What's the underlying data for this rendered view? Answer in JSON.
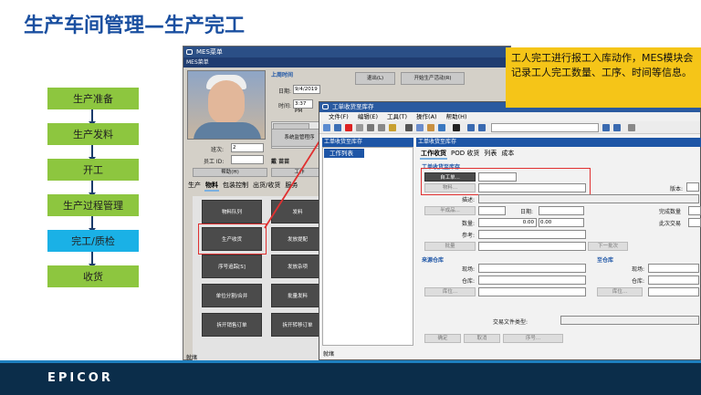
{
  "slide": {
    "title": "生产车间管理—生产完工",
    "footer_logo": "EPICOR"
  },
  "flow": {
    "steps": [
      "生产准备",
      "生产发料",
      "开工",
      "生产过程管理",
      "完工/质检",
      "收货"
    ],
    "active_index": 4
  },
  "callout": {
    "text": "工人完工进行报工入库动作，MES模块会记录工人完工数量、工序、时间等信息。"
  },
  "mes_window": {
    "title": "MES菜单",
    "menu": "MES菜单",
    "clock_header": "上周时间",
    "date_label": "日期:",
    "date_value": "9/4/2019",
    "time_label": "时间:",
    "time_value": "3:37 PM",
    "shift_label": "班次:",
    "shift_value": "2",
    "employee_label": "员工 ID:",
    "employee_value": "",
    "employee_name": "戴 苗苗",
    "help_button": "帮助(H)",
    "work_button": "工作",
    "logout_button": "退出(L)",
    "start_activity_button": "开始生产活动(R)",
    "system_button": "系统监管程序",
    "tabs": [
      "生产",
      "物料",
      "包装控制",
      "出货/收货",
      "服务"
    ],
    "active_tab": "物料",
    "grid_buttons": [
      [
        "物料队列",
        "发料"
      ],
      [
        "生产收货",
        "发放提配"
      ],
      [
        "序号追踪[S]",
        "发放杂项"
      ],
      [
        "单位分割/合并",
        "批量发料"
      ],
      [
        "拆开销售订单",
        "拆开转移订单"
      ]
    ],
    "status": "就绪"
  },
  "receipt_window": {
    "title": "工单收货至库存",
    "menu": [
      "文件(F)",
      "编辑(E)",
      "工具(T)",
      "操作(A)",
      "帮助(H)"
    ],
    "nav_left": "工单收货至库存",
    "nav_right": "工单收货至库存",
    "left_header": "工作列表",
    "tabs": [
      "工作收货",
      "POD 收货",
      "列表",
      "成本"
    ],
    "active_tab": "工作收货",
    "section_title": "工单收货至库存",
    "job_button": "自工单...",
    "material_label": "物料...",
    "revision_label": "版本:",
    "desc_label": "描述:",
    "semi_label": "半成品...",
    "date_label": "日期:",
    "qty_label": "数量:",
    "qty_value": "0.00",
    "qty2_value": "0.00",
    "ref_label": "参考:",
    "completed_label": "完成数量",
    "this_trans_label": "此次交易",
    "lot_label": "批量",
    "next_lot_label": "下一批次",
    "from_wh_title": "来源仓库",
    "to_wh_title": "至仓库",
    "site_label": "现场:",
    "warehouse_label": "仓库:",
    "bin_label": "库位...",
    "trans_type_label": "交易文件类型:",
    "ok_button": "确定",
    "cancel_button": "取消",
    "serial_button": "序号...",
    "status": "就绪"
  },
  "colors": {
    "title": "#1a4fa0",
    "flow_green": "#8dc63f",
    "flow_active": "#1ab1e6",
    "callout": "#f5c518",
    "highlight": "#e03030",
    "footer": "#0b2d4a"
  }
}
